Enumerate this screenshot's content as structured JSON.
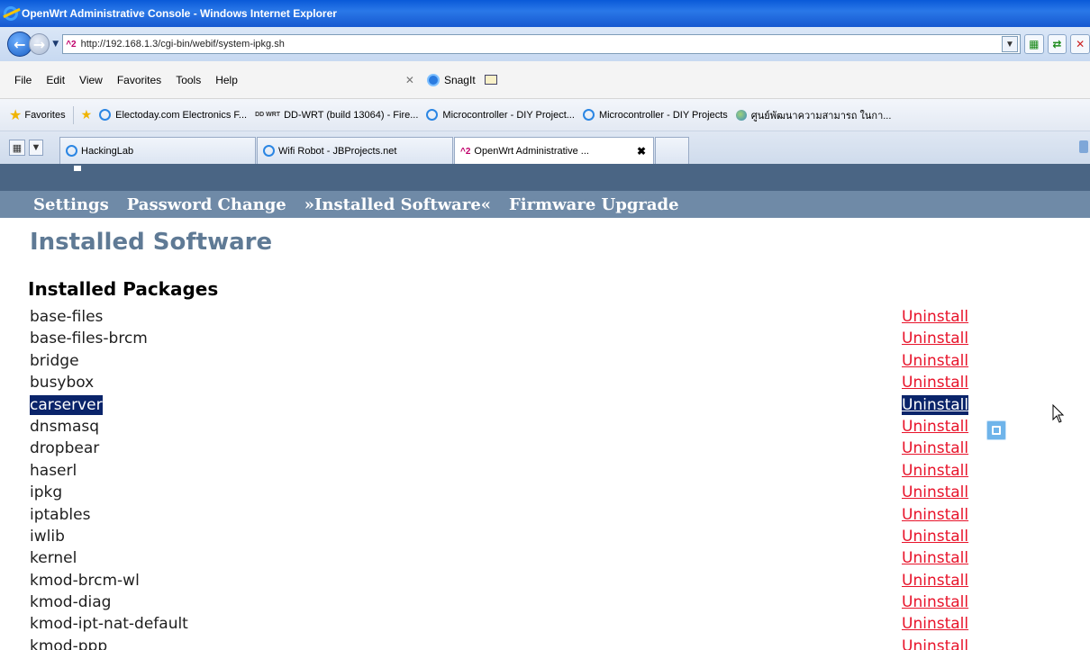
{
  "window": {
    "title": "OpenWrt Administrative Console - Windows Internet Explorer"
  },
  "address": {
    "favicon_text": "^2",
    "url": "http://192.168.1.3/cgi-bin/webif/system-ipkg.sh"
  },
  "menu": {
    "items": [
      "File",
      "Edit",
      "View",
      "Favorites",
      "Tools",
      "Help"
    ],
    "snagit_label": "SnagIt"
  },
  "favorites_bar": {
    "favorites_label": "Favorites",
    "links": [
      "Electoday.com Electronics F...",
      "DD-WRT (build 13064) - Fire...",
      "Microcontroller - DIY Project...",
      "Microcontroller - DIY Projects",
      "ศูนย์พัฒนาความสามารถ ในกา..."
    ],
    "dd_icon_text": "DD WRT"
  },
  "tabs": [
    {
      "label": "HackingLab",
      "active": false
    },
    {
      "label": "Wifi Robot - JBProjects.net",
      "active": false
    },
    {
      "label": "OpenWrt Administrative ...",
      "active": true,
      "favicon_text": "^2"
    }
  ],
  "page": {
    "nav": [
      "Settings",
      "Password Change",
      "»Installed Software«",
      "Firmware Upgrade"
    ],
    "title": "Installed Software",
    "section_title": "Installed Packages",
    "uninstall_label": "Uninstall",
    "packages": [
      "base-files",
      "base-files-brcm",
      "bridge",
      "busybox",
      "carserver",
      "dnsmasq",
      "dropbear",
      "haserl",
      "ipkg",
      "iptables",
      "iwlib",
      "kernel",
      "kmod-brcm-wl",
      "kmod-diag",
      "kmod-ipt-nat-default",
      "kmod-ppp"
    ],
    "selected_package": "carserver"
  },
  "colors": {
    "link": "#e8132a",
    "selection": "#0a246a",
    "nav_band": "#6f8aa7",
    "top_band": "#4a6584",
    "title": "#5f7a95"
  }
}
